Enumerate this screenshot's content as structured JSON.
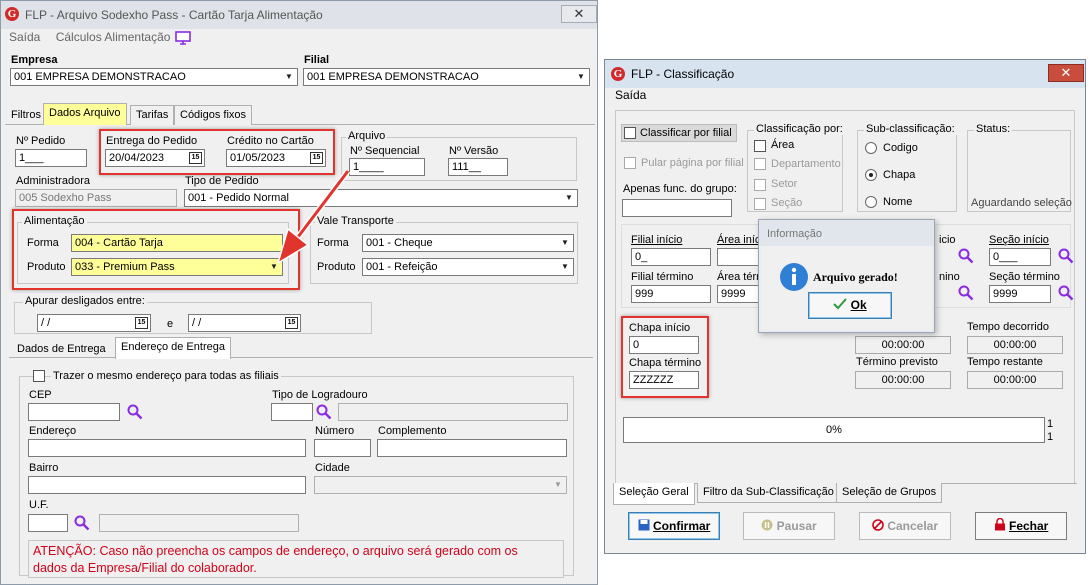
{
  "left_window": {
    "title": "FLP - Arquivo Sodexho Pass - Cartão Tarja Alimentação",
    "menu": [
      "Saída",
      "Cálculos Alimentação"
    ],
    "empresa_label": "Empresa",
    "empresa_value": "001 EMPRESA DEMONSTRACAO",
    "filial_label": "Filial",
    "filial_value": "001 EMPRESA DEMONSTRACAO",
    "tabs": [
      "Filtros",
      "Dados Arquivo",
      "Tarifas",
      "Códigos fixos"
    ],
    "n_pedido_label": "Nº Pedido",
    "n_pedido_value": "1___",
    "entrega_label": "Entrega do Pedido",
    "entrega_value": "20/04/2023",
    "credito_label": "Crédito no Cartão",
    "credito_value": "01/05/2023",
    "arquivo_label": "Arquivo",
    "seq_label": "Nº Sequencial",
    "seq_value": "1____",
    "versao_label": "Nº Versão",
    "versao_value": "111__",
    "administradora_label": "Administradora",
    "administradora_value": "005 Sodexho Pass",
    "tipo_pedido_label": "Tipo de Pedido",
    "tipo_pedido_value": "001 - Pedido Normal",
    "alimentacao_label": "Alimentação",
    "forma_label": "Forma",
    "forma_value": "004 - Cartão Tarja",
    "produto_label": "Produto",
    "produto_value": "033 - Premium Pass",
    "vale_label": "Vale Transporte",
    "vt_forma_label": "Forma",
    "vt_forma_value": "001 - Cheque",
    "vt_produto_label": "Produto",
    "vt_produto_value": "001 - Refeição",
    "apurar_label": "Apurar desligados entre:",
    "apurar_from": " / /",
    "apurar_e": "e",
    "apurar_to": " / /",
    "sub_tabs": [
      "Dados de Entrega",
      "Endereço de Entrega"
    ],
    "trazer_label": "Trazer o mesmo endereço para todas as filiais",
    "cep_label": "CEP",
    "tipo_logradouro_label": "Tipo de Logradouro",
    "endereco_label": "Endereço",
    "numero_label": "Número",
    "complemento_label": "Complemento",
    "bairro_label": "Bairro",
    "cidade_label": "Cidade",
    "uf_label": "U.F.",
    "atencao": "ATENÇÃO: Caso não preencha os campos de endereço, o arquivo será gerado com os dados da Empresa/Filial do colaborador."
  },
  "right_window": {
    "title": "FLP - Classificação",
    "menu": [
      "Saída"
    ],
    "classificar_filial": "Classificar por filial",
    "pular_pagina": "Pular página por filial",
    "apenas_func": "Apenas func. do grupo:",
    "classificacao_por": "Classificação por:",
    "class_options": [
      "Área",
      "Departamento",
      "Setor",
      "Seção"
    ],
    "sub_classificacao": "Sub-classificação:",
    "sub_options": [
      "Codigo",
      "Chapa",
      "Nome"
    ],
    "status_label": "Status:",
    "status_value": "Aguardando seleção",
    "filial_inicio_label": "Filial início",
    "filial_inicio_value": "0_",
    "filial_termino_label": "Filial término",
    "filial_termino_value": "999",
    "area_inicio_label": "Área início",
    "area_termino_label": "Área término",
    "area_termino_value": "9999",
    "secao_inicio_label": "Seção início",
    "secao_inicio_value": "0___",
    "secao_termino_label": "Seção término",
    "secao_termino_value": "9999",
    "partial_inicio": "icio",
    "partial_termino": "nino",
    "chapa_inicio_label": "Chapa início",
    "chapa_inicio_value": "0",
    "chapa_termino_label": "Chapa término",
    "chapa_termino_value": "ZZZZZZ",
    "tempo_decorrido_label": "Tempo decorrido",
    "tempo_decorrido_value": "00:00:00",
    "tempo_partial_value": "00:00:00",
    "termino_previsto_label": "Término previsto",
    "termino_previsto_value": "00:00:00",
    "tempo_restante_label": "Tempo restante",
    "tempo_restante_value": "00:00:00",
    "progress_text": "0%",
    "progress_fraction": 0,
    "progress_side": [
      "1",
      "1"
    ],
    "tabs": [
      "Seleção Geral",
      "Filtro da Sub-Classificação",
      "Seleção de Grupos"
    ],
    "buttons": {
      "confirmar": "Confirmar",
      "pausar": "Pausar",
      "cancelar": "Cancelar",
      "fechar": "Fechar"
    }
  },
  "dialog": {
    "title": "Informação",
    "message": "Arquivo gerado!",
    "ok": "Ok"
  },
  "colors": {
    "highlight_yellow": "#ffff99",
    "annotation_red": "#e0342c",
    "purple_icon": "#8a2be2"
  },
  "icons": [
    "app-logo-icon",
    "monitor-icon",
    "search-icon",
    "calendar-icon",
    "info-icon",
    "check-icon",
    "pause-icon",
    "cancel-icon",
    "lock-icon",
    "save-icon",
    "arrow-annotation"
  ]
}
